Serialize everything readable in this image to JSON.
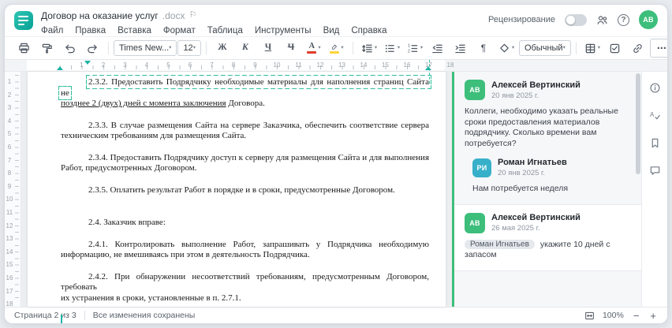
{
  "colors": {
    "accent": "#1db3a6",
    "anchor": "#2fbf9c",
    "avatar_green": "#3dbe7b",
    "avatar_teal": "#38b0c9"
  },
  "window": {
    "title": "Договор на оказание услуг",
    "title_ext": ".docx"
  },
  "header": {
    "review_label": "Рецензирование",
    "avatar_initials": "АВ"
  },
  "menu": {
    "items": [
      "Файл",
      "Правка",
      "Вставка",
      "Формат",
      "Таблица",
      "Инструменты",
      "Вид",
      "Справка"
    ]
  },
  "toolbar": {
    "font_name": "Times New...",
    "font_size": "12",
    "bold": "Ж",
    "italic": "К",
    "underline": "Ч",
    "strikethrough": "Ч",
    "font_color": "А",
    "pilcrow": "¶",
    "style_name": "Обычный",
    "more": "⋯"
  },
  "ruler": {
    "h_numbers": [
      "1",
      "2",
      "3",
      "4",
      "5",
      "6",
      "7",
      "8",
      "9",
      "10",
      "11",
      "12",
      "13",
      "14",
      "15",
      "16",
      "17",
      "18"
    ],
    "v_numbers": [
      "1",
      "2",
      "3",
      "4",
      "5",
      "6",
      "7",
      "8",
      "9",
      "10",
      "11",
      "12",
      "13",
      "14",
      "15",
      "16",
      "17",
      "18"
    ]
  },
  "document": {
    "p232_line1": "2.3.2. Предоставить Подрядчику необходимые материалы для наполнения страниц Сайта не",
    "p232_ins": "позднее 2 (двух) дней с момента заключения",
    "p232_tail": " Договора.",
    "p233": [
      "2.3.3. В случае размещения Сайта на сервере Заказчика, обеспечить соответствие сервера",
      "техническим требованиям для размещения Сайта."
    ],
    "p234": [
      "2.3.4. Предоставить Подрядчику доступ к серверу для размещения Сайта и для выполнения",
      "Работ, предусмотренных Договором."
    ],
    "p235": [
      "2.3.5. Оплатить результат Работ в порядке и в сроки, предусмотренные Договором."
    ],
    "p24": [
      "2.4. Заказчик вправе:"
    ],
    "p241": [
      "2.4.1. Контролировать выполнение Работ, запрашивать у Подрядчика необходимую",
      "информацию, не вмешиваясь при этом в деятельность Подрядчика."
    ],
    "p242": [
      "2.4.2. При обнаружении несоответствий требованиям, предусмотренным Договором, требовать",
      "их устранения в сроки, установленные в п. 2.7.1."
    ]
  },
  "comments": [
    {
      "author": "Алексей Вертинский",
      "initials": "АВ",
      "date": "20 янв 2025 г.",
      "text": "Коллеги, необходимо указать реальные сроки предоставления материалов подрядчику. Сколько времени вам потребуется?",
      "replies": [
        {
          "author": "Роман Игнатьев",
          "initials": "РИ",
          "date": "20 янв 2025 г.",
          "text": "Нам потребуется неделя"
        }
      ]
    },
    {
      "author": "Алексей Вертинский",
      "initials": "АВ",
      "date": "26 мая 2025 г.",
      "mention": "Роман Игнатьев",
      "text": " укажите 10 дней с запасом"
    }
  ],
  "statusbar": {
    "page": "Страница 2 из 3",
    "saved": "Все изменения сохранены",
    "zoom": "100%",
    "zoom_out": "−",
    "zoom_in": "+"
  }
}
